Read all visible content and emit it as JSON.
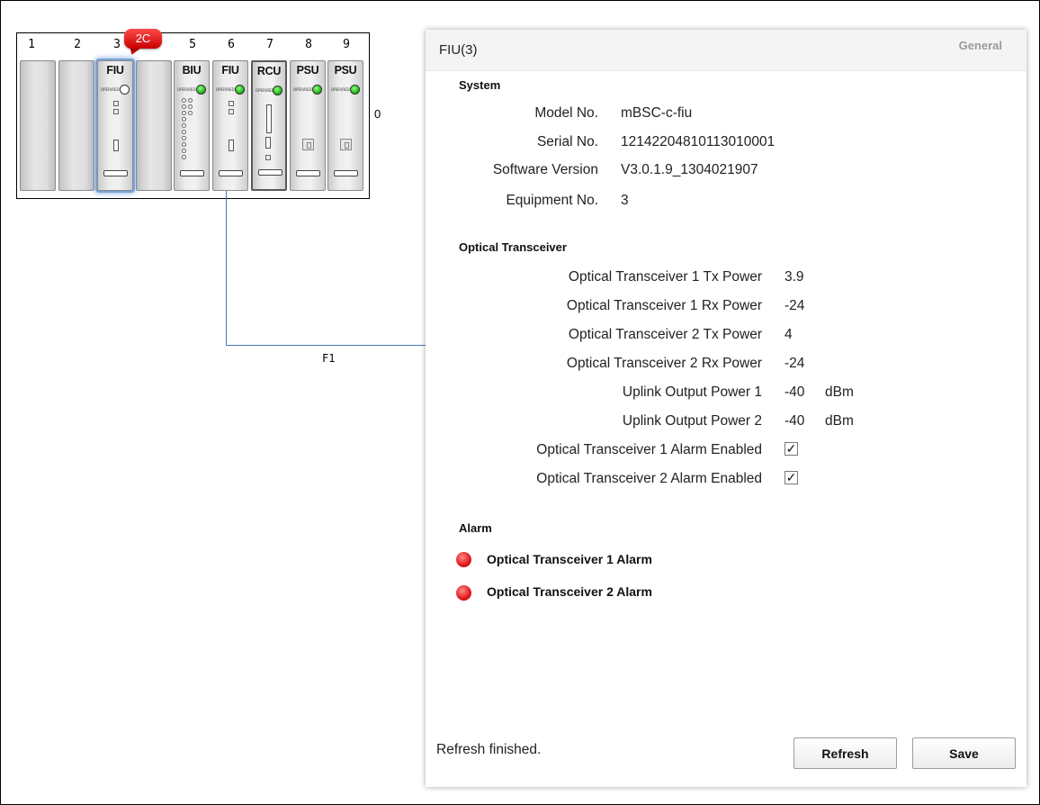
{
  "rack": {
    "slot_numbers": [
      "1",
      "2",
      "3",
      "5",
      "6",
      "7",
      "8",
      "9"
    ],
    "callout": "2C",
    "side_text": "0",
    "cards": {
      "fiu3": "FIU",
      "biu": "BIU",
      "fiu6": "FIU",
      "rcu": "RCU",
      "psu8": "PSU",
      "psu9": "PSU"
    },
    "led_label": "OPER/RED",
    "link_label": "F1"
  },
  "panel": {
    "title": "FIU(3)",
    "tab": "General",
    "system": {
      "heading": "System",
      "fields": [
        {
          "label": "Model No.",
          "value": "mBSC-c-fiu"
        },
        {
          "label": "Serial No.",
          "value": "12142204810113010001"
        },
        {
          "label": "Software Version",
          "value": "V3.0.1.9_1304021907"
        },
        {
          "label": "Equipment No.",
          "value": "3"
        }
      ]
    },
    "optical": {
      "heading": "Optical Transceiver",
      "fields": [
        {
          "label": "Optical Transceiver 1 Tx Power",
          "value": "3.9",
          "unit": ""
        },
        {
          "label": "Optical Transceiver 1 Rx Power",
          "value": "-24",
          "unit": ""
        },
        {
          "label": "Optical Transceiver 2 Tx Power",
          "value": "4",
          "unit": ""
        },
        {
          "label": "Optical Transceiver 2 Rx Power",
          "value": "-24",
          "unit": ""
        },
        {
          "label": "Uplink Output Power 1",
          "value": "-40",
          "unit": "dBm"
        },
        {
          "label": "Uplink Output Power 2",
          "value": "-40",
          "unit": "dBm"
        }
      ],
      "checks": [
        {
          "label": "Optical Transceiver 1 Alarm Enabled",
          "checked": true,
          "mark": "✓"
        },
        {
          "label": "Optical Transceiver 2 Alarm Enabled",
          "checked": true,
          "mark": "✓"
        }
      ]
    },
    "alarm": {
      "heading": "Alarm",
      "items": [
        {
          "label": "Optical Transceiver 1 Alarm",
          "color": "#e01818"
        },
        {
          "label": "Optical Transceiver 2 Alarm",
          "color": "#e01818"
        }
      ]
    },
    "status_text": "Refresh finished.",
    "refresh_label": "Refresh",
    "save_label": "Save"
  }
}
